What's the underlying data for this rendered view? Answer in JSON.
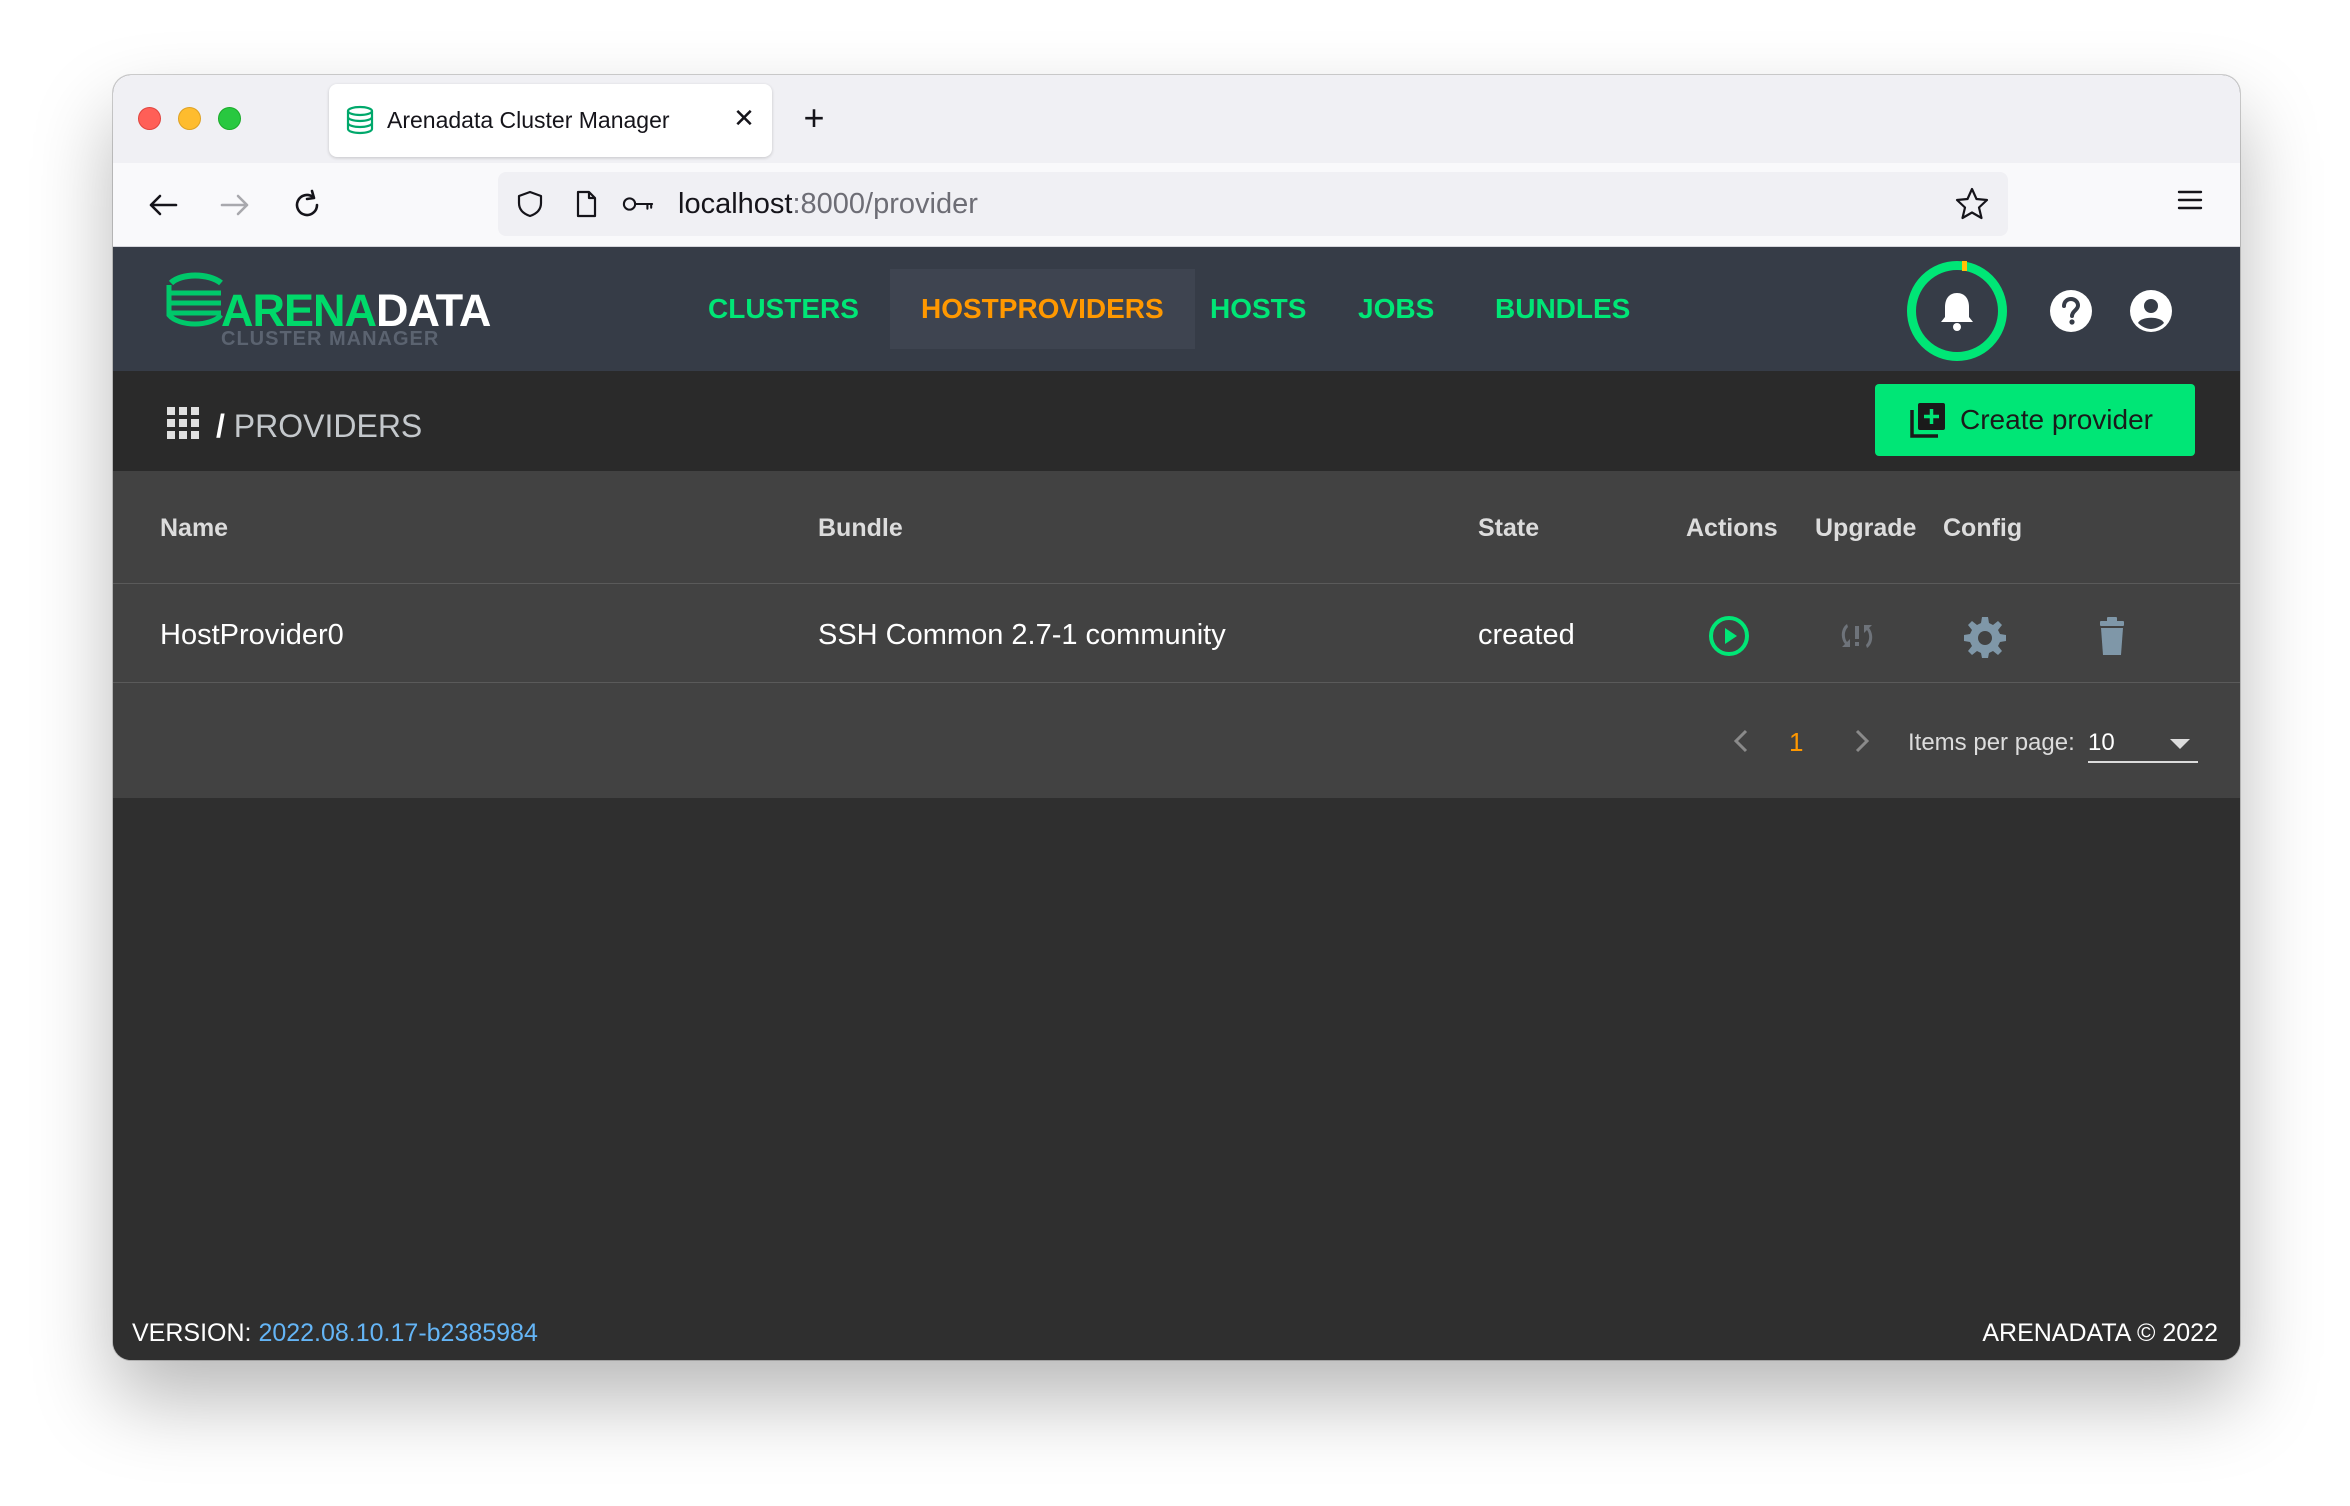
{
  "browser": {
    "tab_title": "Arenadata Cluster Manager",
    "new_tab_symbol": "+",
    "close_symbol": "✕",
    "url_host": "localhost",
    "url_rest": ":8000/provider"
  },
  "app": {
    "logo": {
      "word_a": "ARENA",
      "word_b": "DATA",
      "subtitle": "CLUSTER MANAGER"
    },
    "nav": [
      {
        "label": "CLUSTERS",
        "active": false
      },
      {
        "label": "HOSTPROVIDERS",
        "active": true
      },
      {
        "label": "HOSTS",
        "active": false
      },
      {
        "label": "JOBS",
        "active": false
      },
      {
        "label": "BUNDLES",
        "active": false
      }
    ],
    "icons": {
      "notifications": "bell-icon",
      "help": "help-icon",
      "account": "account-circle-icon"
    }
  },
  "breadcrumb": {
    "slash": "/",
    "current": "PROVIDERS"
  },
  "create_button": {
    "label": "Create provider"
  },
  "table": {
    "headers": {
      "name": "Name",
      "bundle": "Bundle",
      "state": "State",
      "actions": "Actions",
      "upgrade": "Upgrade",
      "config": "Config"
    },
    "rows": [
      {
        "name": "HostProvider0",
        "bundle": "SSH Common 2.7-1 community",
        "state": "created"
      }
    ]
  },
  "pagination": {
    "current_page": "1",
    "items_per_page_label": "Items per page:",
    "items_per_page": "10"
  },
  "footer": {
    "version_label": "VERSION:",
    "version": "2022.08.10.17-b2385984",
    "copyright": "ARENADATA © 2022"
  },
  "colors": {
    "accent_green": "#00e676",
    "accent_orange": "#ff9800",
    "header_bg": "#363c47",
    "link_blue": "#64b5f6"
  }
}
